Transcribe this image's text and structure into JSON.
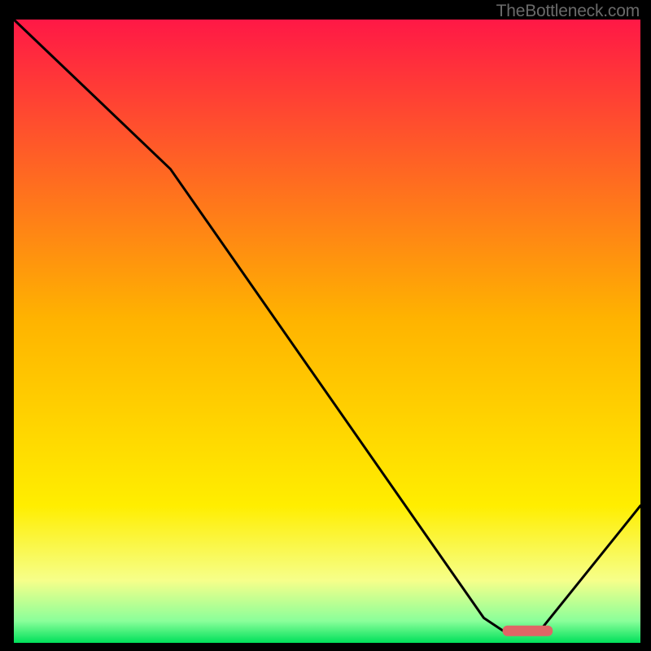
{
  "watermark": "TheBottleneck.com",
  "chart_data": {
    "type": "line",
    "title": "",
    "xlabel": "",
    "ylabel": "",
    "xlim": [
      0,
      100
    ],
    "ylim": [
      0,
      100
    ],
    "grid": false,
    "legend": false,
    "series": [
      {
        "name": "bottleneck-curve",
        "x": [
          0,
          25,
          75,
          78,
          84,
          100
        ],
        "values": [
          100,
          76,
          4,
          2,
          2,
          22
        ]
      }
    ],
    "marker": {
      "name": "optimal-range",
      "x_start": 78,
      "x_end": 86,
      "y": 2,
      "color": "#e06666"
    },
    "background_gradient": {
      "stops": [
        {
          "pos": 0.0,
          "color": "#ff1846"
        },
        {
          "pos": 0.48,
          "color": "#ffb300"
        },
        {
          "pos": 0.78,
          "color": "#ffee00"
        },
        {
          "pos": 0.9,
          "color": "#f6ff8a"
        },
        {
          "pos": 0.965,
          "color": "#8aff9a"
        },
        {
          "pos": 1.0,
          "color": "#00e05a"
        }
      ]
    }
  }
}
